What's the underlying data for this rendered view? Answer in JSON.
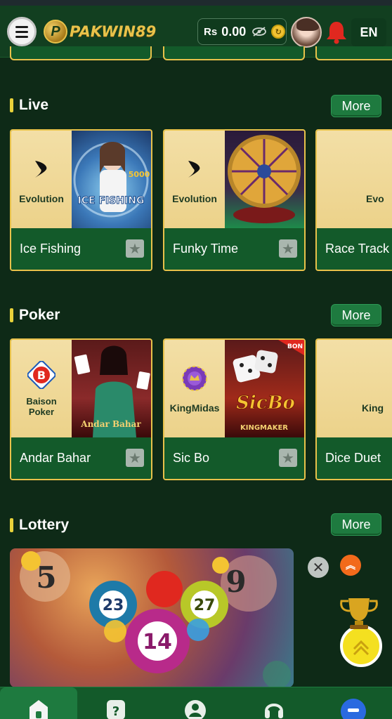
{
  "header": {
    "logo_text": "PAKWIN89",
    "logo_mark": "P",
    "currency_symbol": "Rs",
    "balance": "0.00",
    "coin_icon": "refresh-coin-icon",
    "language": "EN"
  },
  "sections": {
    "live": {
      "title": "Live",
      "more_label": "More",
      "cards": [
        {
          "provider": "Evolution",
          "name": "Ice Fishing"
        },
        {
          "provider": "Evolution",
          "name": "Funky Time"
        },
        {
          "provider": "Evo",
          "name": "Race Track"
        }
      ]
    },
    "poker": {
      "title": "Poker",
      "more_label": "More",
      "cards": [
        {
          "provider_line1": "Baison",
          "provider_line2": "Poker",
          "name": "Andar Bahar"
        },
        {
          "provider": "KingMidas",
          "name": "Sic Bo"
        },
        {
          "provider": "King",
          "name": "Dice Duet"
        }
      ]
    },
    "lottery": {
      "title": "Lottery",
      "more_label": "More",
      "balls": [
        "23",
        "14",
        "27",
        "5",
        "9"
      ]
    }
  },
  "thumbnails": {
    "ice_fishing_title": "ICE FISHING",
    "ice_fishing_tag": "5000",
    "sic_bo_title": "SicBo",
    "sic_bo_sub": "KINGMAKER",
    "sic_bo_badge": "BON",
    "andar_bahar_title": "Andar Bahar"
  },
  "floating": {
    "close_symbol": "✕",
    "scroll_top_symbol": "︽"
  },
  "colors": {
    "background": "#0e2a17",
    "header": "#123f20",
    "card_bottom": "#135a2a",
    "card_border": "#e8c24a",
    "accent_yellow": "#e8d23a",
    "more_button": "#1e7a3f",
    "bell": "#e0281f"
  }
}
